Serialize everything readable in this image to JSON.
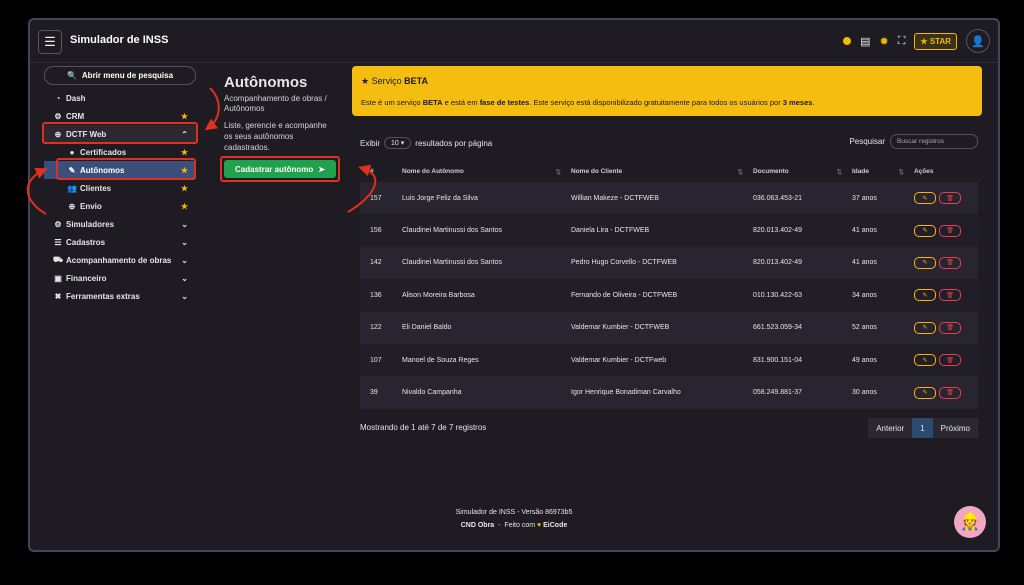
{
  "app": {
    "title": "Simulador de INSS",
    "star_label": "STAR"
  },
  "sidebar": {
    "search_label": "Abrir menu de pesquisa",
    "items": [
      {
        "label": "Dash"
      },
      {
        "label": "CRM"
      },
      {
        "label": "DCTF Web"
      },
      {
        "label": "Certificados"
      },
      {
        "label": "Autônomos"
      },
      {
        "label": "Clientes"
      },
      {
        "label": "Envio"
      },
      {
        "label": "Simuladores"
      },
      {
        "label": "Cadastros"
      },
      {
        "label": "Acompanhamento de obras"
      },
      {
        "label": "Financeiro"
      },
      {
        "label": "Ferramentas extras"
      }
    ]
  },
  "page": {
    "title": "Autônomos",
    "breadcrumb": "Acompanhamento de obras / Autônomos",
    "description": "Liste, gerencie e acompanhe os seus autônomos cadastrados.",
    "new_button": "Cadastrar autônomo"
  },
  "beta": {
    "title_prefix": "Serviço ",
    "title_bold": "BETA",
    "t1": "Este é um serviço ",
    "t2": "BETA",
    "t3": " e está em ",
    "t4": "fase de testes",
    "t5": ". Este serviço está disponibilizado gratuitamente para todos os usuários por ",
    "t6": "3 meses",
    "t7": "."
  },
  "table_controls": {
    "show_label": "Exibir",
    "page_size": "10",
    "per_page_label": "resultados por página",
    "search_label": "Pesquisar",
    "search_placeholder": "Buscar registros"
  },
  "table": {
    "headers": [
      "#",
      "Nome do Autônomo",
      "Nome do Cliente",
      "Documento",
      "Idade",
      "Ações"
    ],
    "rows": [
      {
        "id": "157",
        "name": "Luis Jorge Feliz da Silva",
        "client": "Willian Makeze - DCTFWEB",
        "doc": "036.063.453-21",
        "age": "37 anos"
      },
      {
        "id": "156",
        "name": "Claudinei Martinussi dos Santos",
        "client": "Daniela Lira - DCTFWEB",
        "doc": "820.013.402-49",
        "age": "41 anos"
      },
      {
        "id": "142",
        "name": "Claudinei Martinussi dos Santos",
        "client": "Pedro Hugo Corvello - DCTFWEB",
        "doc": "820.013.402-49",
        "age": "41 anos"
      },
      {
        "id": "136",
        "name": "Alison Moreira Barbosa",
        "client": "Fernando de Oliveira - DCTFWEB",
        "doc": "010.130.422-63",
        "age": "34 anos"
      },
      {
        "id": "122",
        "name": "Eli Daniel Baldo",
        "client": "Valdemar Kumbier - DCTFWEB",
        "doc": "661.523.059-34",
        "age": "52 anos"
      },
      {
        "id": "107",
        "name": "Manoel de Souza Reges",
        "client": "Valdemar Kumbier - DCTFweb",
        "doc": "831.900.151-04",
        "age": "49 anos"
      },
      {
        "id": "39",
        "name": "Nivaldo Campanha",
        "client": "Igor Henrique Bonadiman Carvalho",
        "doc": "058.249.881-37",
        "age": "30 anos"
      }
    ],
    "showing": "Mostrando de 1 até 7 de 7 registros",
    "prev": "Anterior",
    "current_page": "1",
    "next": "Próximo"
  },
  "footer": {
    "version": "Simulador de INSS - Versão 86973b5",
    "brand": "CND Obra",
    "sep": "-",
    "made_with": "Feito com",
    "author": "EiCode"
  },
  "colors": {
    "accent": "#f5bd10",
    "success": "#1fa14e",
    "danger": "#e8404a",
    "highlight": "#e0301e"
  }
}
